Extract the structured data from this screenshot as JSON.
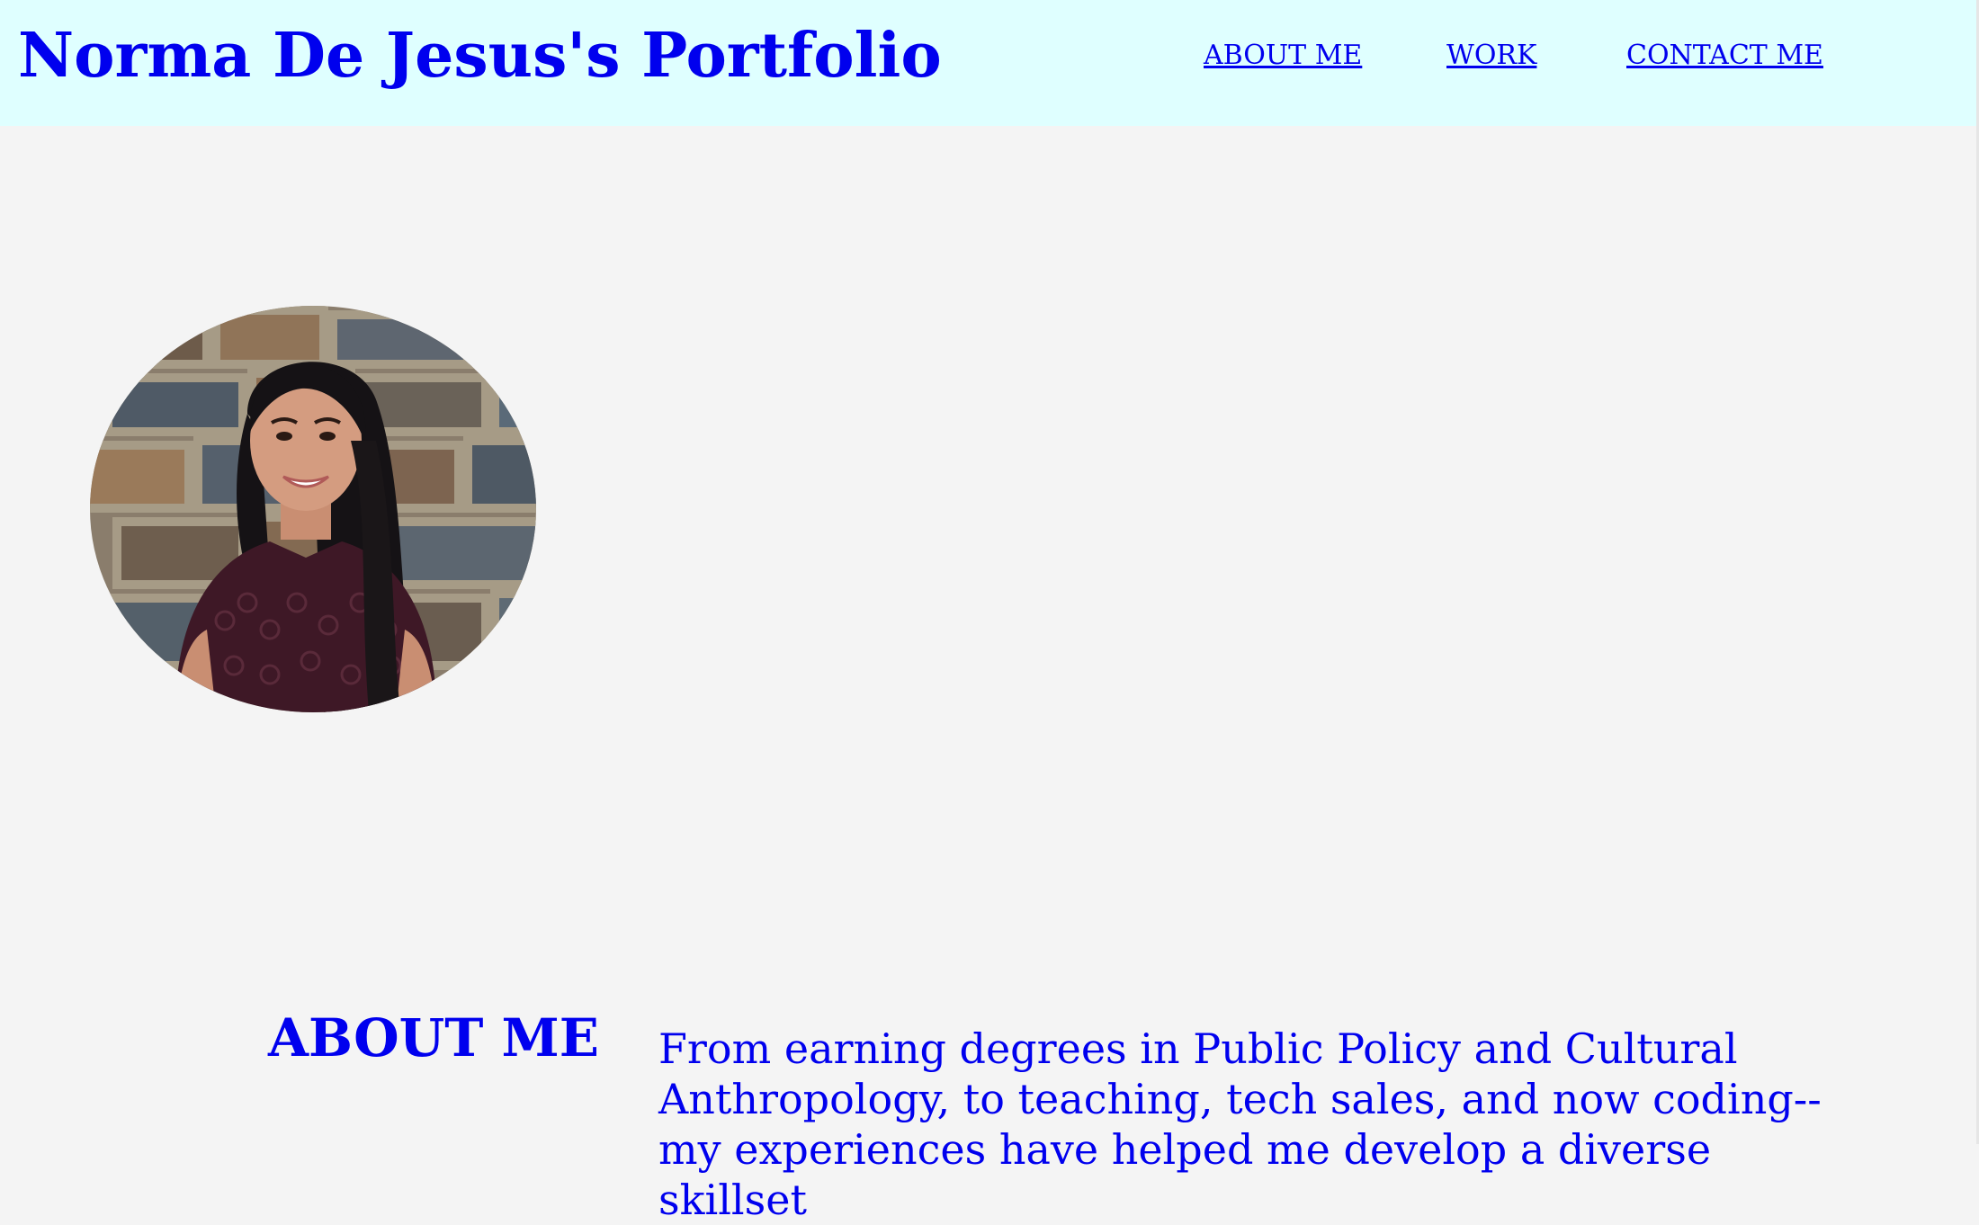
{
  "header": {
    "title": "Norma De Jesus's Portfolio",
    "nav": [
      {
        "label": "ABOUT ME"
      },
      {
        "label": "WORK"
      },
      {
        "label": "CONTACT ME"
      }
    ]
  },
  "hero": {
    "photo_alt": "Portrait of Norma De Jesus in front of a stone brick wall"
  },
  "about": {
    "heading": "ABOUT ME",
    "text": "From earning degrees in Public Policy and Cultural Anthropology, to teaching, tech sales, and now coding--my experiences have helped me develop a diverse skillset"
  },
  "colors": {
    "header_bg": "#dfffff",
    "page_bg": "#f4f4f4",
    "link": "#0000ee"
  }
}
